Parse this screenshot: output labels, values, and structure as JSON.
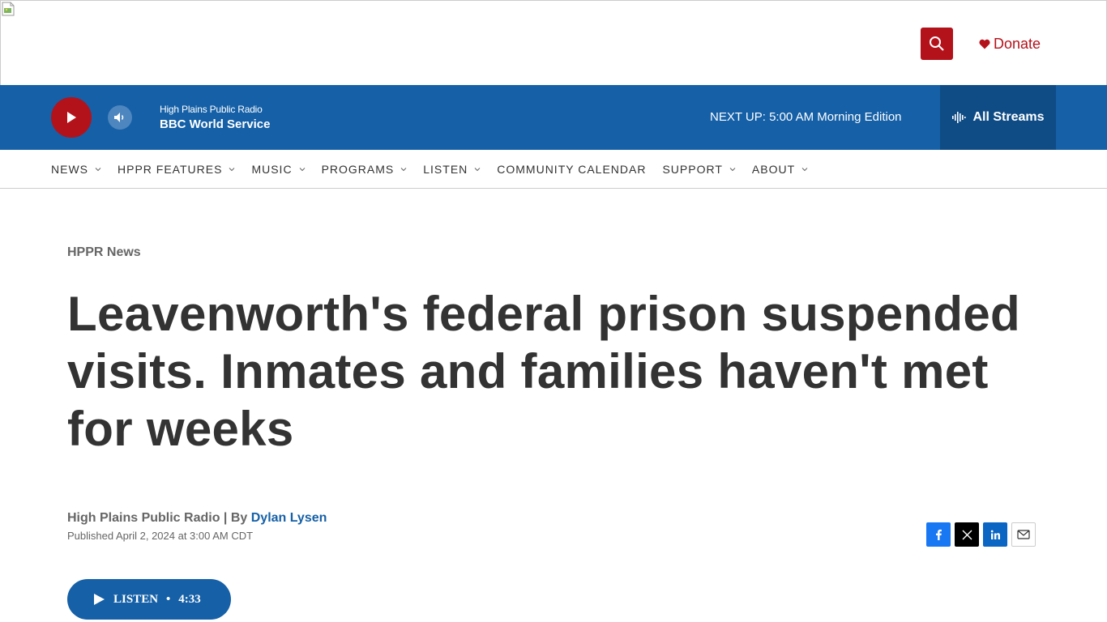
{
  "header": {
    "donate_label": "Donate",
    "accent_color": "#b4121b"
  },
  "player": {
    "station_name": "High Plains Public Radio",
    "program": "BBC World Service",
    "next_up": "NEXT UP: 5:00 AM Morning Edition",
    "all_streams_label": "All Streams",
    "bar_color": "#1560a7"
  },
  "nav": {
    "items": [
      {
        "label": "NEWS",
        "has_dropdown": true
      },
      {
        "label": "HPPR FEATURES",
        "has_dropdown": true
      },
      {
        "label": "MUSIC",
        "has_dropdown": true
      },
      {
        "label": "PROGRAMS",
        "has_dropdown": true
      },
      {
        "label": "LISTEN",
        "has_dropdown": true
      },
      {
        "label": "COMMUNITY CALENDAR",
        "has_dropdown": false
      },
      {
        "label": "SUPPORT",
        "has_dropdown": true
      },
      {
        "label": "ABOUT",
        "has_dropdown": true
      }
    ]
  },
  "article": {
    "category": "HPPR News",
    "headline": "Leavenworth's federal prison suspended visits. Inmates and families haven't met for weeks",
    "byline_source": "High Plains Public Radio | By ",
    "author": "Dylan Lysen",
    "published": "Published April 2, 2024 at 3:00 AM CDT",
    "listen_label": "LISTEN",
    "listen_separator": "•",
    "listen_duration": "4:33"
  },
  "share": {
    "icons": [
      "facebook-icon",
      "x-twitter-icon",
      "linkedin-icon",
      "email-icon"
    ]
  }
}
